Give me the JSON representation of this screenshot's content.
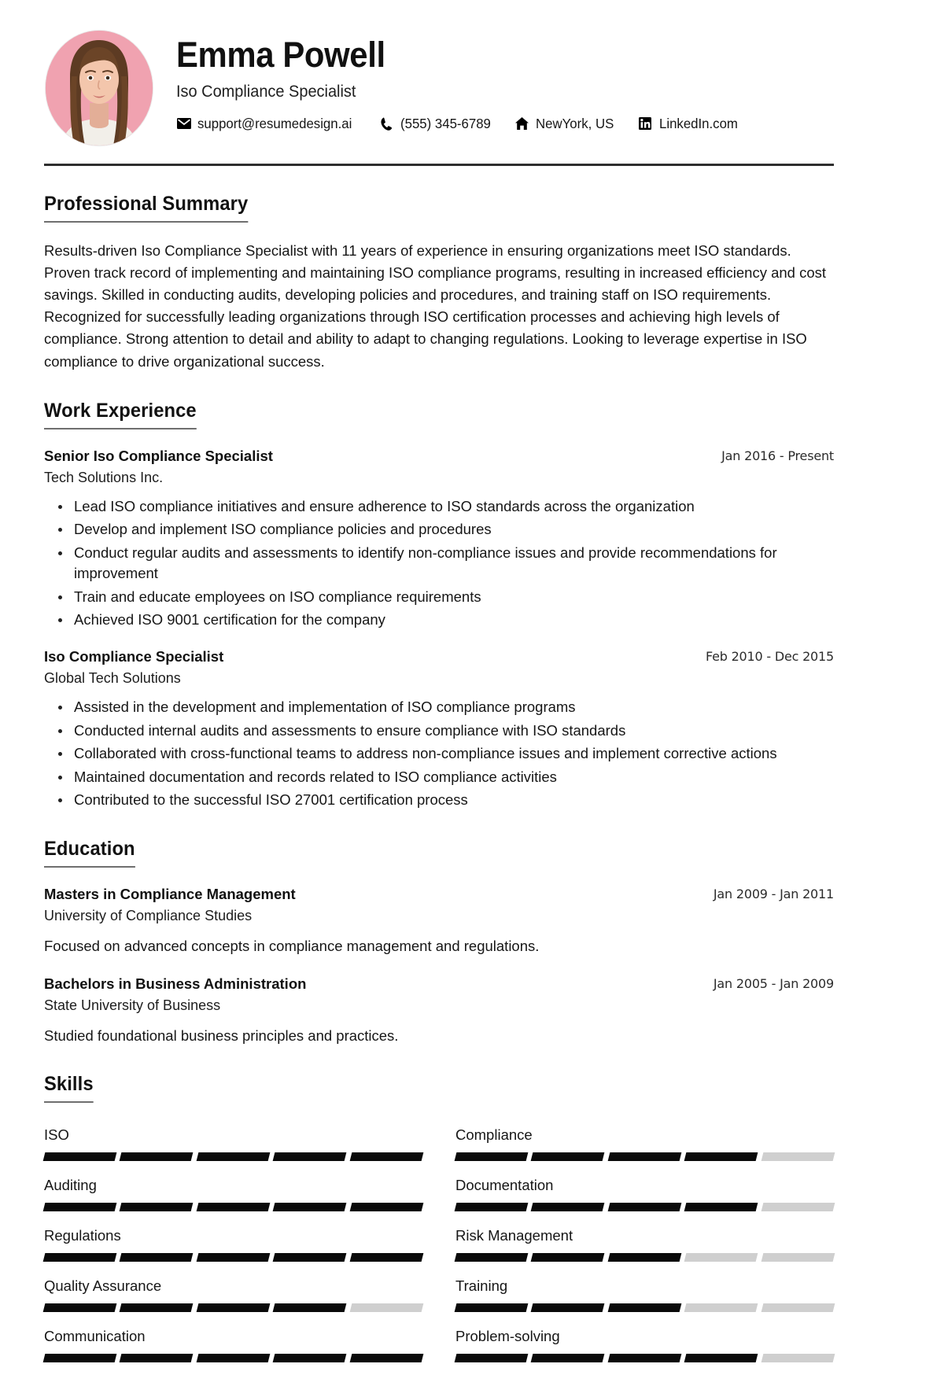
{
  "header": {
    "name": "Emma Powell",
    "job_title": "Iso Compliance Specialist",
    "avatar_alt": "profile-photo",
    "avatar_bg": "#f0a2b0",
    "contacts": [
      {
        "icon": "envelope-icon",
        "label": "support@resumedesign.ai"
      },
      {
        "icon": "phone-icon",
        "label": "(555) 345-6789"
      },
      {
        "icon": "home-icon",
        "label": "NewYork, US"
      },
      {
        "icon": "linkedin-icon",
        "label": "LinkedIn.com"
      }
    ]
  },
  "summary": {
    "title": "Professional Summary",
    "text": "Results-driven Iso Compliance Specialist with 11 years of experience in ensuring organizations meet ISO standards. Proven track record of implementing and maintaining ISO compliance programs, resulting in increased efficiency and cost savings. Skilled in conducting audits, developing policies and procedures, and training staff on ISO requirements. Recognized for successfully leading organizations through ISO certification processes and achieving high levels of compliance. Strong attention to detail and ability to adapt to changing regulations. Looking to leverage expertise in ISO compliance to drive organizational success."
  },
  "work": {
    "title": "Work Experience",
    "entries": [
      {
        "role": "Senior Iso Compliance Specialist",
        "date": "Jan 2016 - Present",
        "org": "Tech Solutions Inc.",
        "bullets": [
          "Lead ISO compliance initiatives and ensure adherence to ISO standards across the organization",
          "Develop and implement ISO compliance policies and procedures",
          "Conduct regular audits and assessments to identify non-compliance issues and provide recommendations for improvement",
          "Train and educate employees on ISO compliance requirements",
          "Achieved ISO 9001 certification for the company"
        ]
      },
      {
        "role": "Iso Compliance Specialist",
        "date": "Feb 2010 - Dec 2015",
        "org": "Global Tech Solutions",
        "bullets": [
          "Assisted in the development and implementation of ISO compliance programs",
          "Conducted internal audits and assessments to ensure compliance with ISO standards",
          "Collaborated with cross-functional teams to address non-compliance issues and implement corrective actions",
          "Maintained documentation and records related to ISO compliance activities",
          "Contributed to the successful ISO 27001 certification process"
        ]
      }
    ]
  },
  "education": {
    "title": "Education",
    "entries": [
      {
        "degree": "Masters in Compliance Management",
        "date": "Jan 2009 - Jan 2011",
        "school": "University of Compliance Studies",
        "desc": "Focused on advanced concepts in compliance management and regulations."
      },
      {
        "degree": "Bachelors in Business Administration",
        "date": "Jan 2005 - Jan 2009",
        "school": "State University of Business",
        "desc": "Studied foundational business principles and practices."
      }
    ]
  },
  "skills": {
    "title": "Skills",
    "total_segments": 5,
    "items": [
      {
        "name": "ISO",
        "level": 5
      },
      {
        "name": "Compliance",
        "level": 4
      },
      {
        "name": "Auditing",
        "level": 5
      },
      {
        "name": "Documentation",
        "level": 4
      },
      {
        "name": "Regulations",
        "level": 5
      },
      {
        "name": "Risk Management",
        "level": 3
      },
      {
        "name": "Quality Assurance",
        "level": 4
      },
      {
        "name": "Training",
        "level": 3
      },
      {
        "name": "Communication",
        "level": 5
      },
      {
        "name": "Problem-solving",
        "level": 4
      }
    ]
  },
  "colors": {
    "segment_on": "#0a0a0a",
    "segment_off": "#cfcfcf",
    "rule": "#2e2e2e",
    "accent_pink": "#f0a2b0"
  }
}
